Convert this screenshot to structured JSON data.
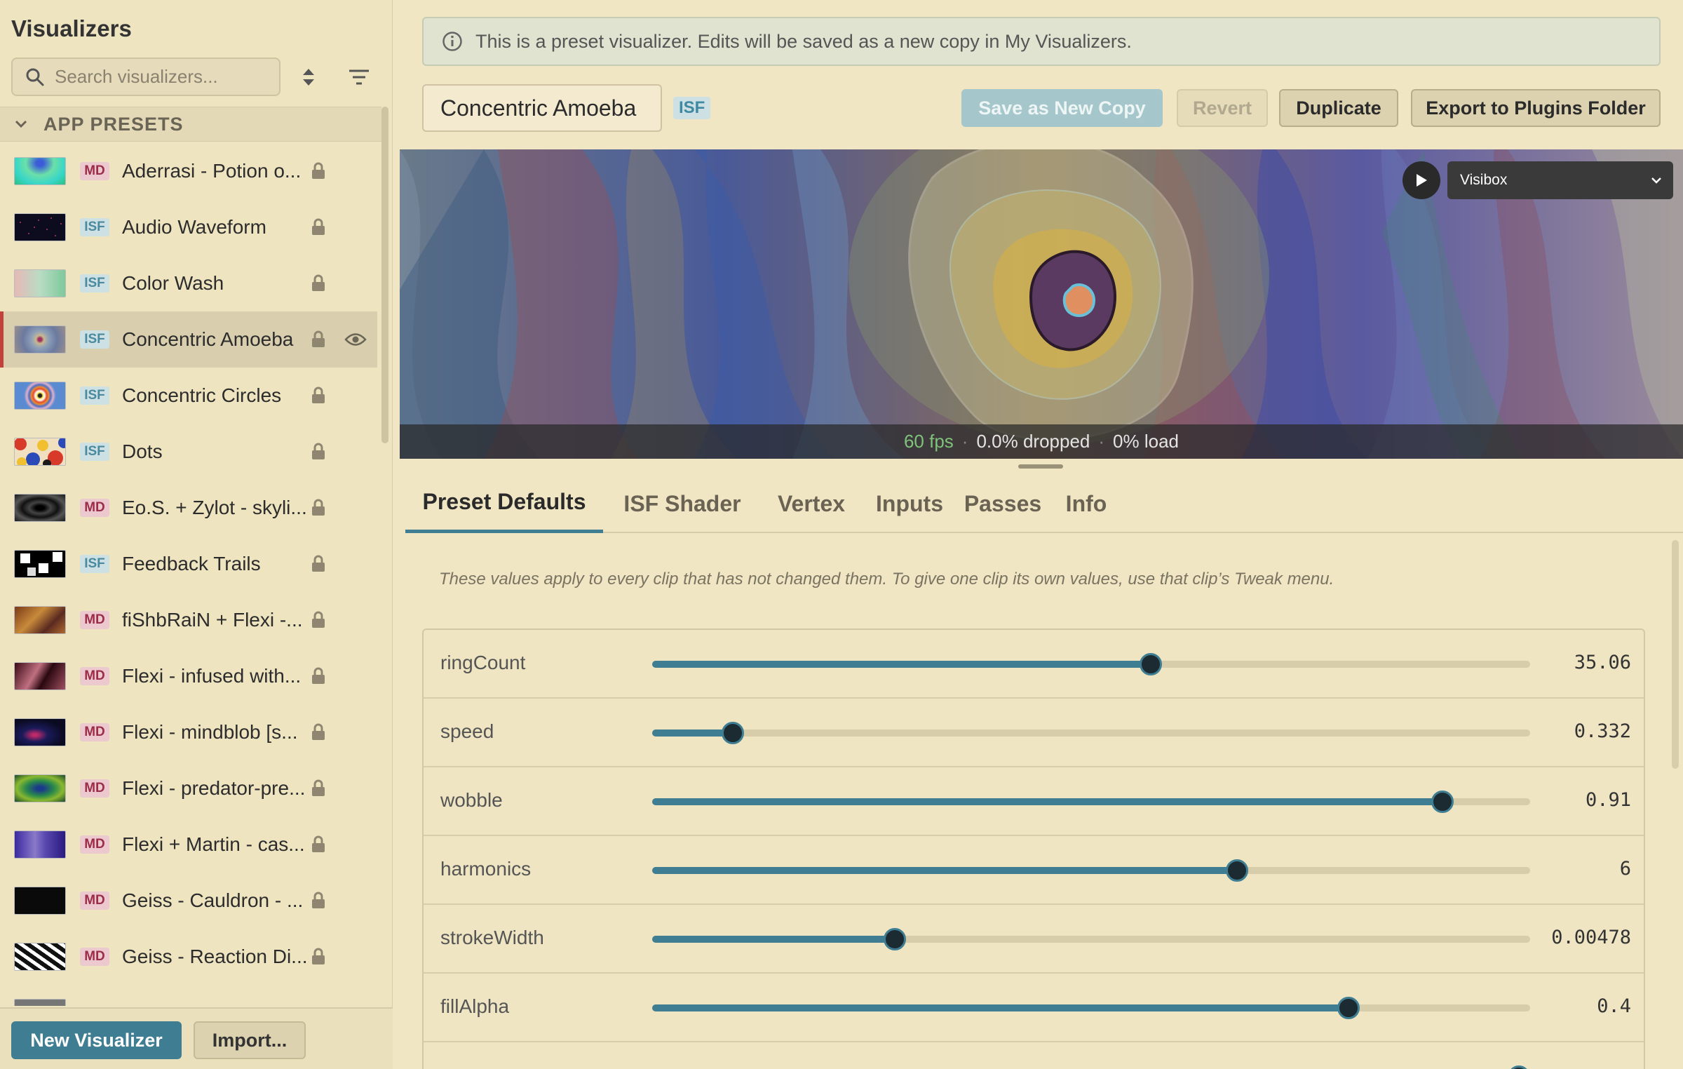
{
  "sidebar": {
    "title": "Visualizers",
    "search_placeholder": "Search visualizers...",
    "section_label": "APP PRESETS",
    "items": [
      {
        "badge": "MD",
        "name": "Aderrasi - Potion o..."
      },
      {
        "badge": "ISF",
        "name": "Audio Waveform"
      },
      {
        "badge": "ISF",
        "name": "Color Wash"
      },
      {
        "badge": "ISF",
        "name": "Concentric Amoeba",
        "selected": true
      },
      {
        "badge": "ISF",
        "name": "Concentric Circles"
      },
      {
        "badge": "ISF",
        "name": "Dots"
      },
      {
        "badge": "MD",
        "name": "Eo.S. + Zylot - skyli..."
      },
      {
        "badge": "ISF",
        "name": "Feedback Trails"
      },
      {
        "badge": "MD",
        "name": "fiShbRaiN + Flexi -..."
      },
      {
        "badge": "MD",
        "name": "Flexi - infused with..."
      },
      {
        "badge": "MD",
        "name": "Flexi - mindblob [s..."
      },
      {
        "badge": "MD",
        "name": "Flexi - predator-pre..."
      },
      {
        "badge": "MD",
        "name": "Flexi + Martin - cas..."
      },
      {
        "badge": "MD",
        "name": "Geiss - Cauldron - ..."
      },
      {
        "badge": "MD",
        "name": "Geiss - Reaction Di..."
      }
    ],
    "new_button": "New Visualizer",
    "import_button": "Import..."
  },
  "banner": {
    "text": "This is a preset visualizer. Edits will be saved as a new copy in My Visualizers.",
    "icon": "info-icon"
  },
  "editor": {
    "name": "Concentric Amoeba",
    "type_badge": "ISF",
    "save_copy": "Save as New Copy",
    "revert": "Revert",
    "duplicate": "Duplicate",
    "export": "Export to Plugins Folder"
  },
  "preview": {
    "output": "Visibox",
    "fps": "60 fps",
    "dropped": "0.0% dropped",
    "load": "0% load",
    "separator": "·"
  },
  "tabs": [
    {
      "label": "Preset Defaults",
      "active": true
    },
    {
      "label": "ISF Shader"
    },
    {
      "label": "Vertex"
    },
    {
      "label": "Inputs"
    },
    {
      "label": "Passes"
    },
    {
      "label": "Info"
    }
  ],
  "panel": {
    "hint": "These values apply to every clip that has not changed them. To give one clip its own values, use that clip’s Tweak menu."
  },
  "params": [
    {
      "name": "ringCount",
      "value": "35.06",
      "fraction": 0.568
    },
    {
      "name": "speed",
      "value": "0.332",
      "fraction": 0.092
    },
    {
      "name": "wobble",
      "value": "0.91",
      "fraction": 0.9
    },
    {
      "name": "harmonics",
      "value": "6",
      "fraction": 0.666
    },
    {
      "name": "strokeWidth",
      "value": "0.00478",
      "fraction": 0.276
    },
    {
      "name": "fillAlpha",
      "value": "0.4",
      "fraction": 0.793
    },
    {
      "name": "",
      "value": "",
      "fraction": 0.987
    }
  ],
  "colors": {
    "accent": "#3f7d92",
    "selected_marker": "#c2413b",
    "md_badge": "#9c2c48",
    "isf_badge": "#4a8a9e"
  }
}
